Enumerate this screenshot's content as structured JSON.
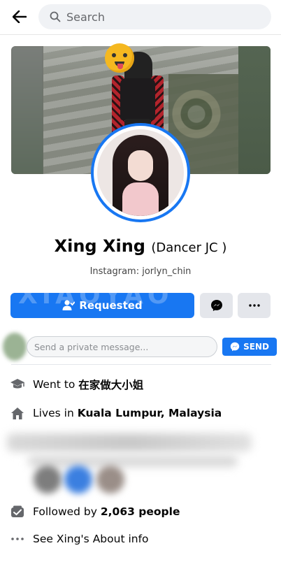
{
  "header": {
    "search_placeholder": "Search"
  },
  "profile": {
    "name": "Xing Xing",
    "nickname": "(Dancer JC )",
    "bio": "Instagram: jorlyn_chin",
    "watermark": "XIAOYAO"
  },
  "actions": {
    "requested_label": "Requested"
  },
  "message_bar": {
    "placeholder": "Send a private message...",
    "send_label": "SEND"
  },
  "info": {
    "went_to_prefix": "Went to",
    "went_to_value": "在家做大小姐",
    "lives_prefix": "Lives in",
    "lives_value": "Kuala Lumpur, Malaysia",
    "followed_prefix": "Followed by",
    "followed_value": "2,063 people",
    "about_label": "See Xing's About info"
  },
  "colors": {
    "accent": "#1877f2",
    "secondary_button": "#e4e6eb",
    "text": "#050505"
  },
  "icons": {
    "back": "arrow-left-icon",
    "search": "search-icon",
    "messenger": "messenger-icon",
    "more": "more-icon",
    "education": "graduation-cap-icon",
    "home": "home-icon",
    "followers": "followers-icon",
    "about": "ellipsis-icon"
  }
}
